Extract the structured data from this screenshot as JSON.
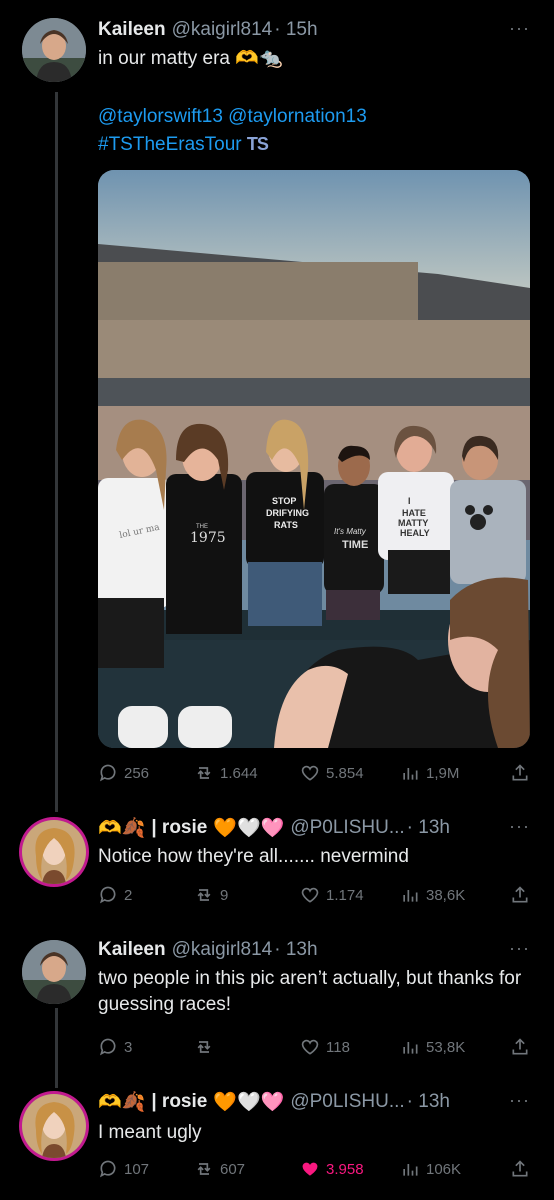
{
  "tweets": [
    {
      "name": "Kaileen",
      "handle": "@kaigirl814",
      "time": "· 15h",
      "text": "in our matty era",
      "emoji": "🫶🐀",
      "mentions": "@taylorswift13 @taylornation13",
      "hashtag": "#TSTheErasTour",
      "hashtag_badge": "TS",
      "image_texts": {
        "shirt1": "lol ur ma",
        "shirt2": "THE 1975",
        "shirt3": "STOP DRIFYING RATS",
        "shirt4": "It's Matty TIME",
        "shirt5": "I HATE MATTY HEALY"
      },
      "replies": "256",
      "retweets": "1.644",
      "likes": "5.854",
      "views": "1,9M"
    },
    {
      "name_prefix": "🫶🍂",
      "name": "| rosie",
      "name_suffix": "🧡🤍🩷",
      "handle": "@P0LISHU...",
      "time": "· 13h",
      "text": "Notice how they're all....... nevermind",
      "replies": "2",
      "retweets": "9",
      "likes": "1.174",
      "views": "38,6K"
    },
    {
      "name": "Kaileen",
      "handle": "@kaigirl814",
      "time": "· 13h",
      "text": "two people in this pic aren’t actually, but thanks for guessing races!",
      "replies": "3",
      "retweets": "",
      "likes": "118",
      "views": "53,8K"
    },
    {
      "name_prefix": "🫶🍂",
      "name": "| rosie",
      "name_suffix": "🧡🤍🩷",
      "handle": "@P0LISHU...",
      "time": "· 13h",
      "text": "I meant ugly",
      "replies": "107",
      "retweets": "607",
      "likes": "3.958",
      "views": "106K"
    }
  ],
  "more_glyph": "···",
  "colors": {
    "link": "#1d9bf0",
    "like": "#f91880",
    "muted": "#71767b",
    "bg": "#000000"
  }
}
